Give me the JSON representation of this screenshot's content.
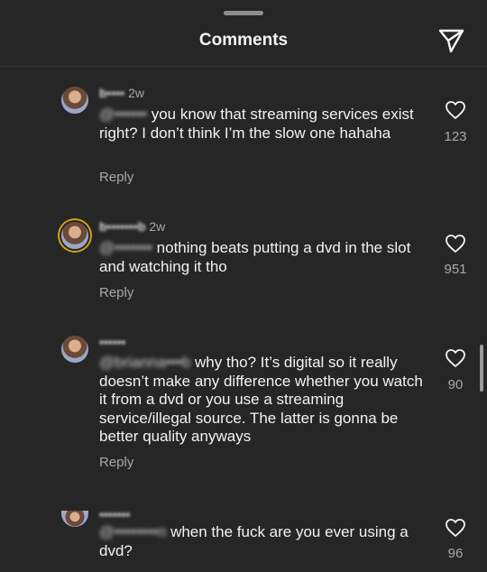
{
  "header": {
    "title": "Comments"
  },
  "icons": {
    "share": "paper-plane-icon",
    "like": "heart-outline-icon"
  },
  "colors": {
    "background": "#262626",
    "text": "#f5f5f5",
    "secondary_text": "#a8a8a8",
    "story_ring": "#d4a017"
  },
  "comments": [
    {
      "username": "b••••",
      "time": "2w",
      "mention": "@••••••",
      "body": "you know that streaming services exist right? I don’t think I’m the slow one hahaha",
      "reply_label": "Reply",
      "likes": "123"
    },
    {
      "username": "b•••••••b",
      "time": "2w",
      "mention": "@•••••••",
      "body": "nothing beats putting a dvd in the slot and watching it tho",
      "reply_label": "Reply",
      "likes": "951"
    },
    {
      "username": "••••••",
      "time": "",
      "mention": "@brianna•••b",
      "body": "why tho? It’s digital so it really doesn’t make any difference whether you watch it from a dvd or you use a streaming service/illegal source. The latter is gonna be better quality anyways",
      "reply_label": "Reply",
      "likes": "90"
    },
    {
      "username": "•••••••",
      "time": "",
      "mention": "@••••••••n",
      "body": "when the fuck are you ever using a dvd?",
      "reply_label": "",
      "likes": "96"
    }
  ]
}
